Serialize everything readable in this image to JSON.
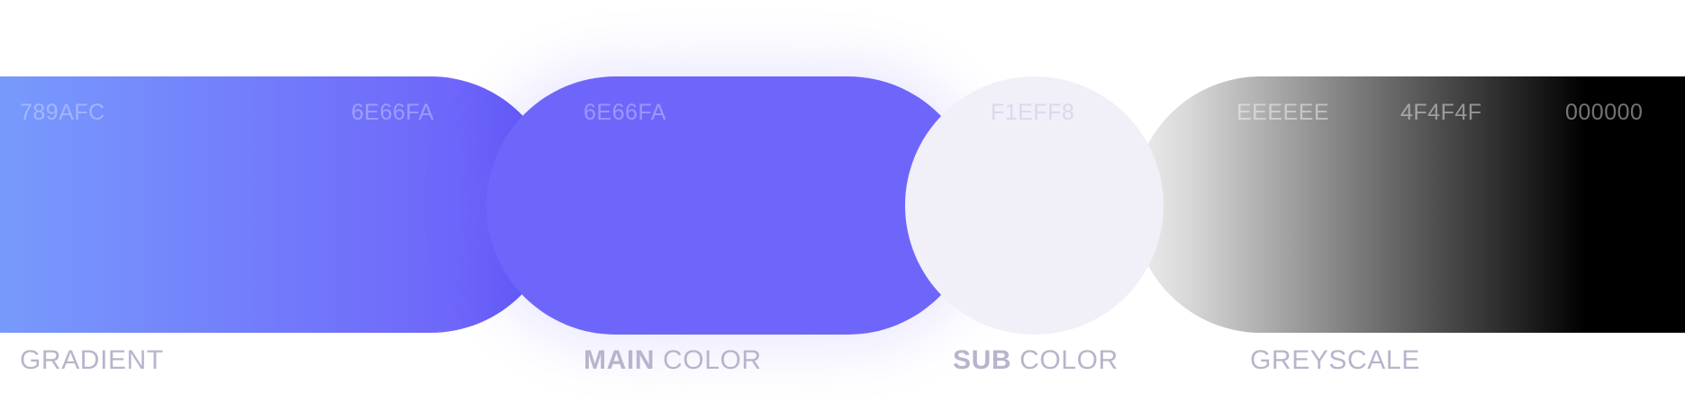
{
  "swatches": {
    "gradient": {
      "start_hex": "789AFC",
      "end_hex": "6E66FA",
      "label": "GRADIENT"
    },
    "main": {
      "hex": "6E66FA",
      "label_bold": "MAIN",
      "label_rest": "COLOR"
    },
    "sub": {
      "hex": "F1EFF8",
      "label_bold": "SUB",
      "label_rest": "COLOR"
    },
    "greyscale": {
      "light_hex": "EEEEEE",
      "mid_hex": "4F4F4F",
      "dark_hex": "000000",
      "label": "GREYSCALE"
    }
  },
  "colors": {
    "gradient_start": "#789AFC",
    "main": "#6E66FA",
    "sub": "#F1EFF8",
    "grey_light": "#EEEEEE",
    "grey_mid": "#4F4F4F",
    "grey_dark": "#000000",
    "label_text": "#B8B4CC"
  }
}
